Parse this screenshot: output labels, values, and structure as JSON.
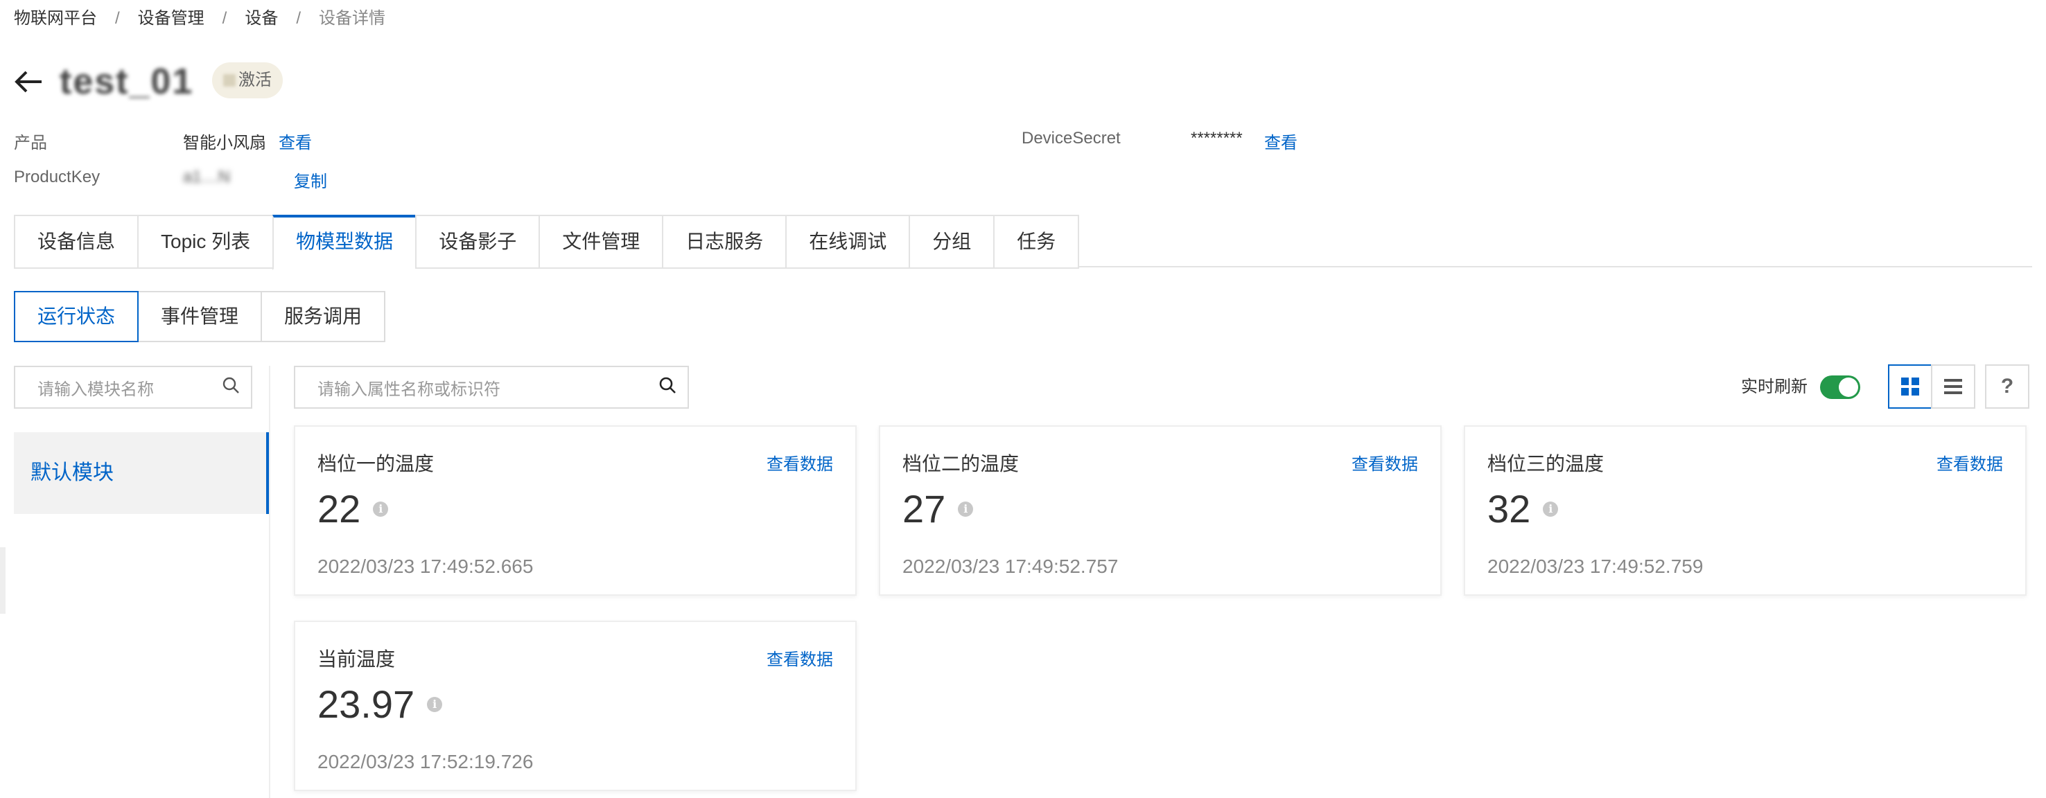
{
  "breadcrumb": [
    "物联网平台",
    "设备管理",
    "设备",
    "设备详情"
  ],
  "breadcrumb_separator": "/",
  "device": {
    "name": "test_01",
    "status_badge": "激活"
  },
  "meta": {
    "product_label": "产品",
    "product_value": "智能小风扇",
    "product_link": "查看",
    "productkey_label": "ProductKey",
    "productkey_value": "a1…N",
    "productkey_link": "复制",
    "secret_label": "DeviceSecret",
    "secret_value": "********",
    "secret_link": "查看"
  },
  "tabs": [
    "设备信息",
    "Topic 列表",
    "物模型数据",
    "设备影子",
    "文件管理",
    "日志服务",
    "在线调试",
    "分组",
    "任务"
  ],
  "active_tab": "物模型数据",
  "subtabs": [
    "运行状态",
    "事件管理",
    "服务调用"
  ],
  "active_subtab": "运行状态",
  "module_search_placeholder": "请输入模块名称",
  "property_search_placeholder": "请输入属性名称或标识符",
  "modules": [
    "默认模块"
  ],
  "realtime_refresh_label": "实时刷新",
  "realtime_refresh_on": true,
  "help_label": "?",
  "cards": [
    {
      "name": "档位一的温度",
      "link": "查看数据",
      "value": "22",
      "timestamp": "2022/03/23 17:49:52.665"
    },
    {
      "name": "档位二的温度",
      "link": "查看数据",
      "value": "27",
      "timestamp": "2022/03/23 17:49:52.757"
    },
    {
      "name": "档位三的温度",
      "link": "查看数据",
      "value": "32",
      "timestamp": "2022/03/23 17:49:52.759"
    },
    {
      "name": "当前温度",
      "link": "查看数据",
      "value": "23.97",
      "timestamp": "2022/03/23 17:52:19.726"
    }
  ],
  "colors": {
    "accent": "#0064c8",
    "toggle_on": "#23994a",
    "border": "#e3e3e3"
  }
}
